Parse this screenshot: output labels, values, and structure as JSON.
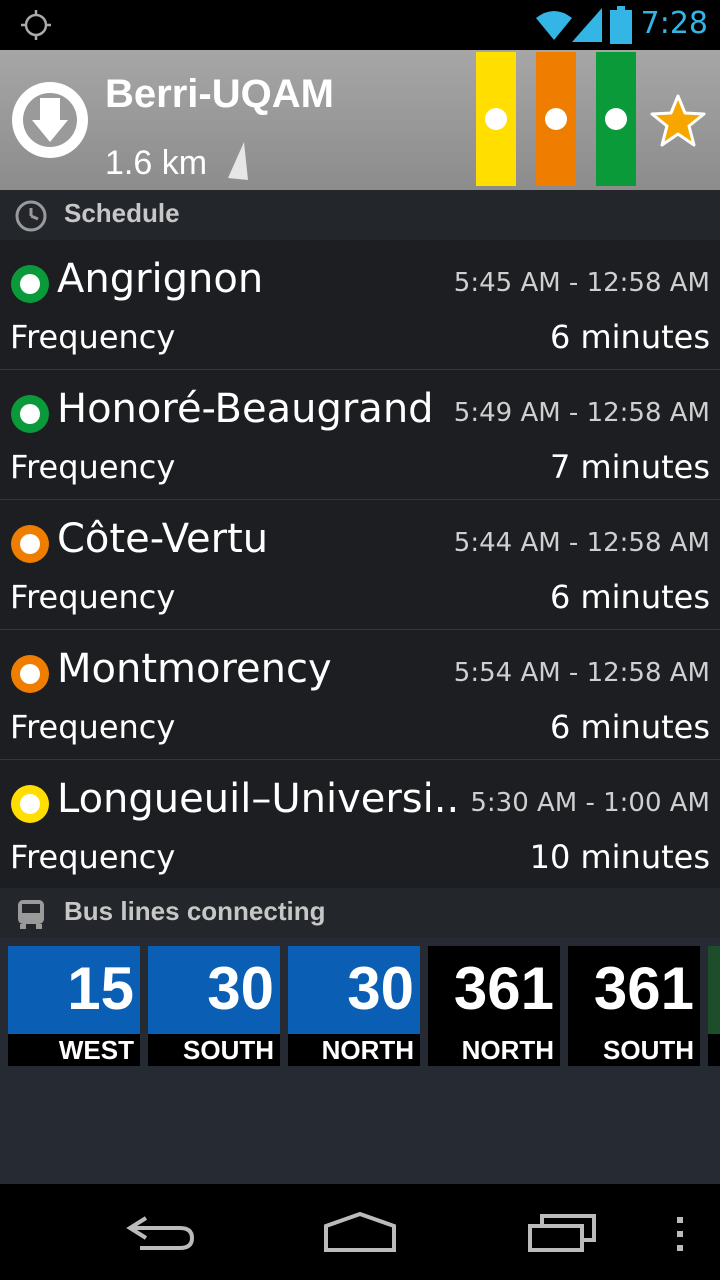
{
  "status_bar": {
    "time": "7:28",
    "icons": [
      "location-icon",
      "wifi-icon",
      "signal-icon",
      "battery-icon"
    ]
  },
  "station": {
    "name": "Berri-UQAM",
    "distance": "1.6 km",
    "lines": [
      {
        "color": "#ffde00",
        "name": "yellow"
      },
      {
        "color": "#ee7d00",
        "name": "orange"
      },
      {
        "color": "#0b9a3a",
        "name": "green"
      }
    ],
    "favorite_icon": "star-icon"
  },
  "schedule": {
    "label": "Schedule",
    "frequency_label": "Frequency",
    "rows": [
      {
        "destination": "Angrignon",
        "hours": "5:45 AM - 12:58 AM",
        "frequency": "6 minutes",
        "color": "#0b9a3a"
      },
      {
        "destination": "Honoré-Beaugrand",
        "hours": "5:49 AM - 12:58 AM",
        "frequency": "7 minutes",
        "color": "#0b9a3a"
      },
      {
        "destination": "Côte-Vertu",
        "hours": "5:44 AM - 12:58 AM",
        "frequency": "6 minutes",
        "color": "#ee7d00"
      },
      {
        "destination": "Montmorency",
        "hours": "5:54 AM - 12:58 AM",
        "frequency": "6 minutes",
        "color": "#ee7d00"
      },
      {
        "destination": "Longueuil–Universi..",
        "hours": "5:30 AM - 1:00 AM",
        "frequency": "10 minutes",
        "color": "#ffde00"
      }
    ]
  },
  "bus": {
    "label": "Bus lines connecting",
    "tiles": [
      {
        "number": "15",
        "direction": "WEST",
        "color": "#0a5fb4"
      },
      {
        "number": "30",
        "direction": "SOUTH",
        "color": "#0a5fb4"
      },
      {
        "number": "30",
        "direction": "NORTH",
        "color": "#0a5fb4"
      },
      {
        "number": "361",
        "direction": "NORTH",
        "color": "#000000"
      },
      {
        "number": "361",
        "direction": "SOUTH",
        "color": "#000000"
      }
    ]
  },
  "nav": {
    "buttons": [
      "back-icon",
      "home-icon",
      "recent-apps-icon",
      "menu-icon"
    ]
  }
}
